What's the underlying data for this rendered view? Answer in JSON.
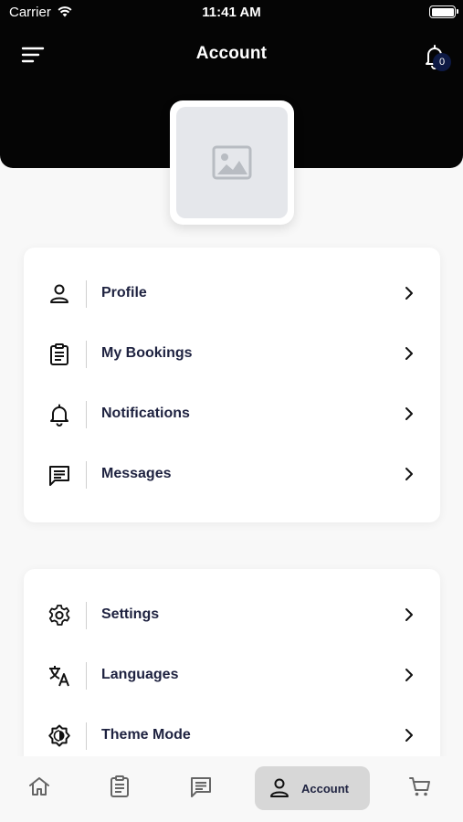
{
  "status_bar": {
    "carrier": "Carrier",
    "time": "11:41 AM"
  },
  "header": {
    "title": "Account",
    "notification_count": "0"
  },
  "menu_group_1": [
    {
      "label": "Profile",
      "icon": "person-icon"
    },
    {
      "label": "My Bookings",
      "icon": "clipboard-icon"
    },
    {
      "label": "Notifications",
      "icon": "bell-icon"
    },
    {
      "label": "Messages",
      "icon": "message-icon"
    }
  ],
  "menu_group_2": [
    {
      "label": "Settings",
      "icon": "gear-icon"
    },
    {
      "label": "Languages",
      "icon": "translate-icon"
    },
    {
      "label": "Theme Mode",
      "icon": "theme-icon"
    }
  ],
  "bottom_nav": {
    "items": [
      {
        "icon": "home-icon"
      },
      {
        "icon": "clipboard-icon"
      },
      {
        "icon": "message-icon"
      },
      {
        "icon": "person-icon",
        "label": "Account",
        "active": true
      },
      {
        "icon": "cart-icon"
      }
    ]
  },
  "colors": {
    "header_bg": "#050505",
    "text": "#1e2240",
    "badge": "#0e1a44",
    "active_tab": "#d7d7d7"
  }
}
